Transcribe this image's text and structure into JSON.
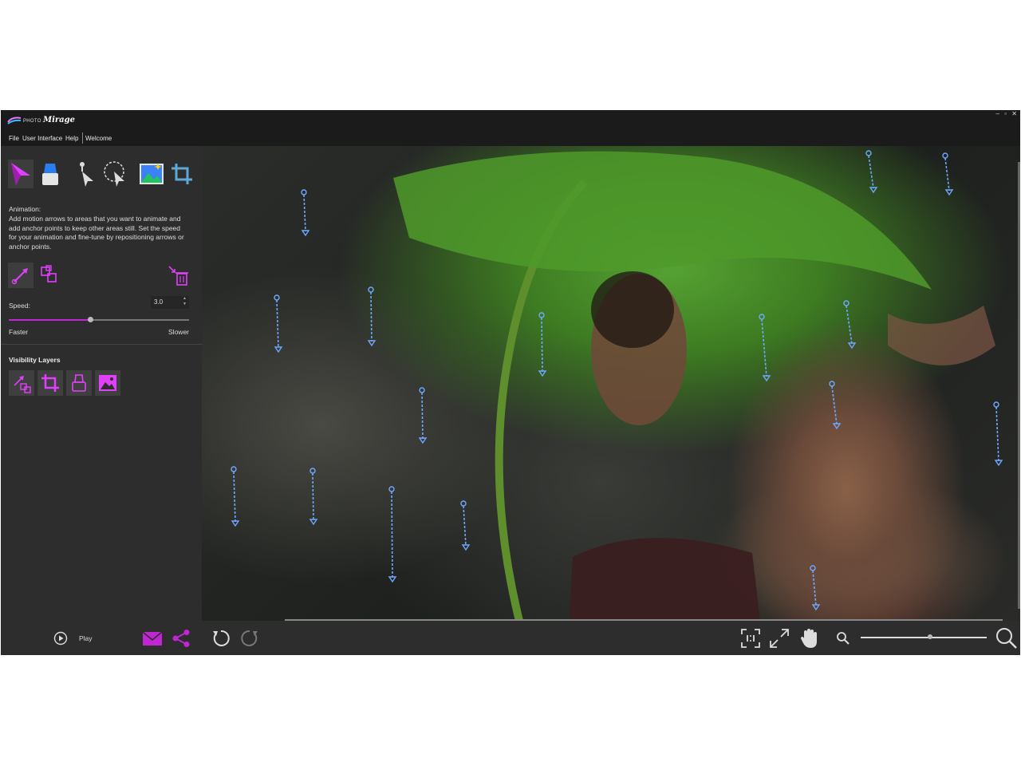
{
  "app": {
    "logo_small": "PHOTO",
    "logo_big": "Mirage",
    "window_controls": [
      "–",
      "▫",
      "✕"
    ]
  },
  "menu": [
    "File",
    "User Interface",
    "Help",
    "Welcome"
  ],
  "tools": [
    "motion-arrow",
    "eraser",
    "select",
    "lasso-select",
    "image-adjust",
    "crop"
  ],
  "animation": {
    "heading": "Animation:",
    "description": "Add motion arrows to areas that you want to animate and add anchor points to keep other areas still. Set the speed for your animation and fine-tune by repositioning arrows or anchor points."
  },
  "speed": {
    "label": "Speed:",
    "value": "3.0",
    "slider_fraction": 0.45,
    "faster_label": "Faster",
    "slower_label": "Slower"
  },
  "visibility": {
    "heading": "Visibility Layers",
    "layers": [
      "motion-arrows",
      "crop",
      "mask",
      "image"
    ]
  },
  "bottom": {
    "play_label": "Play",
    "zoom_fraction": 0.55
  },
  "colors": {
    "accent": "#c026d3",
    "arrow": "#6fa8ff",
    "panel": "#2d2d2d",
    "titlebar": "#1b1b1b"
  }
}
